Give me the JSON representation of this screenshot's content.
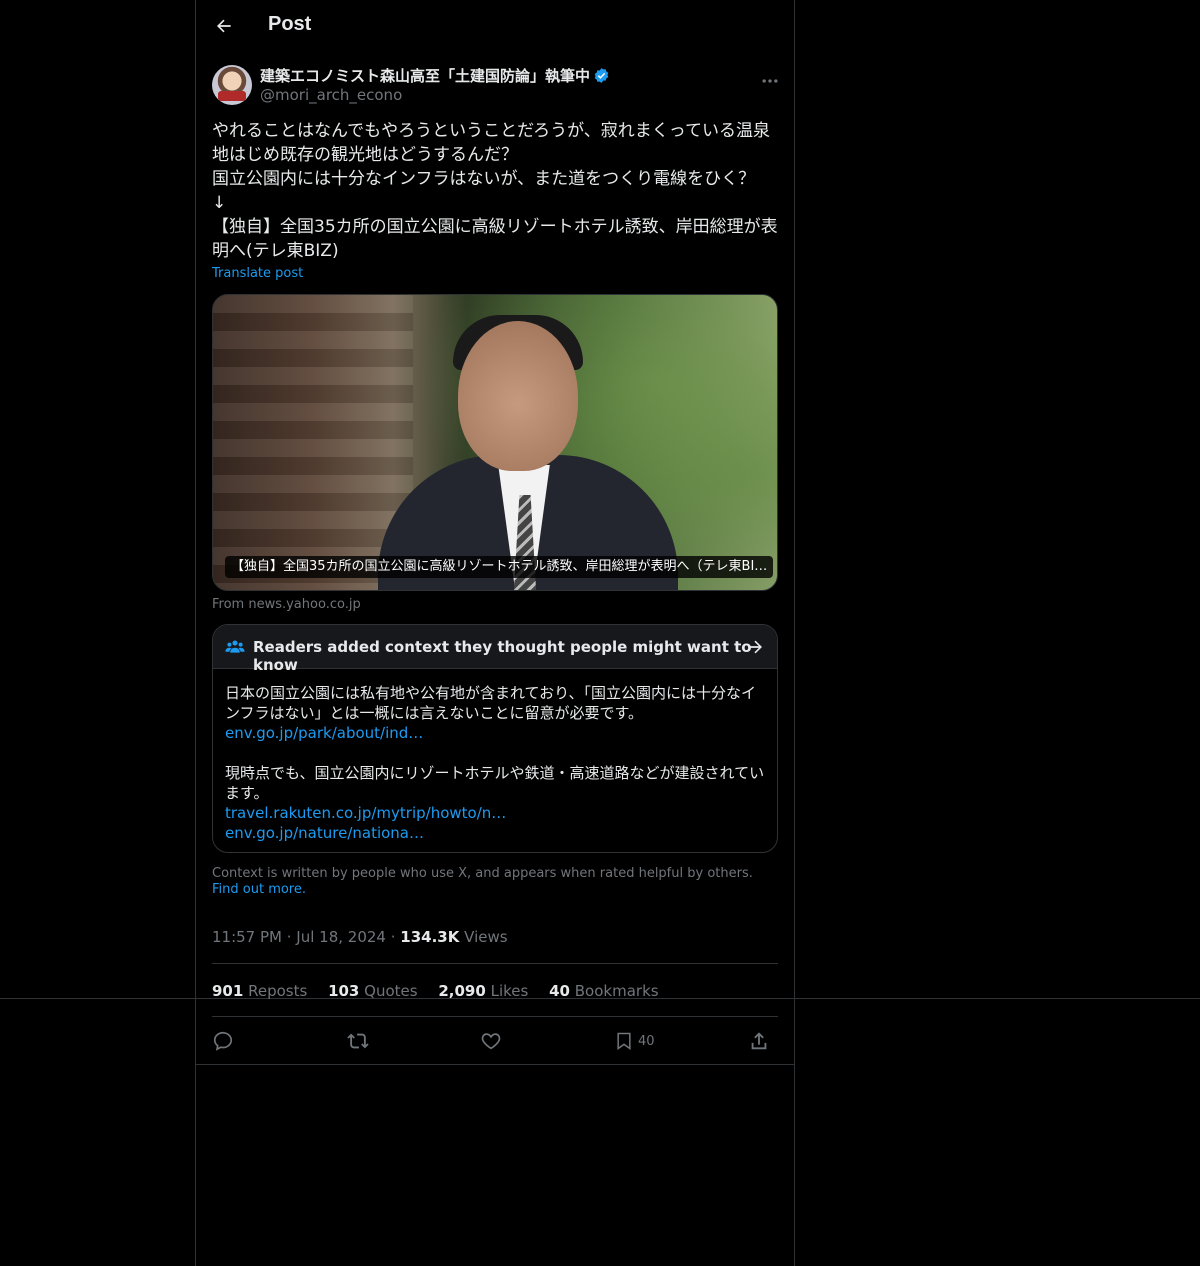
{
  "header": {
    "title": "Post"
  },
  "author": {
    "display_name": "建築エコノミスト森山高至「土建国防論」執筆中",
    "handle": "@mori_arch_econo"
  },
  "tweet": {
    "text": "やれることはなんでもやろうということだろうが、寂れまくっている温泉\n地はじめ既存の観光地はどうするんだ？\n国立公園内には十分なインフラはないが、また道をつくり電線をひく？\n↓\n【独自】全国35カ所の国立公園に高級リゾートホテル誘致、岸田総理が表\n明へ(テレ東BIZ)",
    "translate_label": "Translate post"
  },
  "media": {
    "caption": "【独自】全国35カ所の国立公園に高級リゾートホテル誘致、岸田総理が表明へ（テレ東BI…",
    "source": "From news.yahoo.co.jp"
  },
  "community_note": {
    "title": "Readers added context they thought people might want to know",
    "paragraph1": "日本の国立公園には私有地や公有地が含まれており、「国立公園内には十分なインフラはない」とは一概には言えないことに留意が必要です。",
    "link1": "env.go.jp/park/about/ind…",
    "paragraph2": "現時点でも、国立公園内にリゾートホテルや鉄道・高速道路などが建設されています。",
    "link2": "travel.rakuten.co.jp/mytrip/howto/n…",
    "link3": "env.go.jp/nature/nationa…"
  },
  "context_footer": {
    "text": "Context is written by people who use X, and appears when rated helpful by others.",
    "find_out": "Find out more."
  },
  "meta": {
    "time": "11:57 PM",
    "date": "Jul 18, 2024",
    "views_count": "134.3K",
    "views_label": "Views"
  },
  "stats": {
    "reposts_count": "901",
    "reposts_label": "Reposts",
    "quotes_count": "103",
    "quotes_label": "Quotes",
    "likes_count": "2,090",
    "likes_label": "Likes",
    "bookmarks_count": "40",
    "bookmarks_label": "Bookmarks"
  },
  "actions": {
    "bookmark_count": "40"
  },
  "icons": [
    "back-arrow-icon",
    "verified-badge-icon",
    "more-icon",
    "community-notes-icon",
    "arrow-right-icon",
    "reply-icon",
    "repost-icon",
    "like-icon",
    "bookmark-icon",
    "share-icon"
  ],
  "colors": {
    "background": "#000000",
    "text": "#e7e9ea",
    "muted": "#71767b",
    "accent": "#1d9bf0",
    "border": "#2f3336"
  }
}
